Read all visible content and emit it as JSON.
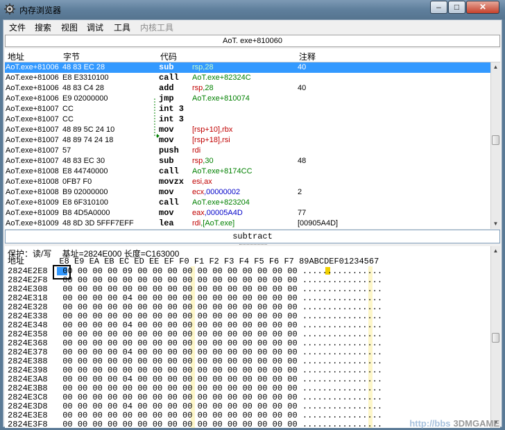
{
  "window": {
    "title": "内存浏览器",
    "minimize": "–",
    "maximize": "□",
    "close": "✕"
  },
  "menu": [
    "文件",
    "搜索",
    "视图",
    "调试",
    "工具",
    "内核工具"
  ],
  "address_bar": "AoT. exe+810060",
  "disasm": {
    "headers": {
      "address": "地址",
      "bytes": "字节",
      "opcode": "代码",
      "comment": "注释"
    },
    "rows": [
      {
        "address": "AoT.exe+81006",
        "bytes": "48 83 EC 28",
        "opcode": "sub",
        "args": [
          [
            "r",
            "rsp"
          ],
          [
            "g",
            ",28"
          ]
        ],
        "comment": "40"
      },
      {
        "address": "AoT.exe+81006",
        "bytes": "E8 E3310100",
        "opcode": "call",
        "args": [
          [
            "g",
            "AoT.exe+82324C"
          ]
        ],
        "comment": ""
      },
      {
        "address": "AoT.exe+81006",
        "bytes": "48 83 C4 28",
        "opcode": "add",
        "args": [
          [
            "r",
            "rsp"
          ],
          [
            "g",
            ",28"
          ]
        ],
        "comment": "40"
      },
      {
        "address": "AoT.exe+81006",
        "bytes": "E9 02000000",
        "opcode": "jmp",
        "args": [
          [
            "g",
            "AoT.exe+810074"
          ]
        ],
        "comment": ""
      },
      {
        "address": "AoT.exe+81007",
        "bytes": "CC",
        "opcode": "int 3",
        "args": [],
        "comment": ""
      },
      {
        "address": "AoT.exe+81007",
        "bytes": "CC",
        "opcode": "int 3",
        "args": [],
        "comment": ""
      },
      {
        "address": "AoT.exe+81007",
        "bytes": "48 89 5C 24 10",
        "opcode": "mov",
        "args": [
          [
            "r",
            "[rsp+10]"
          ],
          [
            "r",
            ",rbx"
          ]
        ],
        "comment": ""
      },
      {
        "address": "AoT.exe+81007",
        "bytes": "48 89 74 24 18",
        "opcode": "mov",
        "args": [
          [
            "r",
            "[rsp+18]"
          ],
          [
            "r",
            ",rsi"
          ]
        ],
        "comment": ""
      },
      {
        "address": "AoT.exe+81007",
        "bytes": "57",
        "opcode": "push",
        "args": [
          [
            "r",
            "rdi"
          ]
        ],
        "comment": ""
      },
      {
        "address": "AoT.exe+81007",
        "bytes": "48 83 EC 30",
        "opcode": "sub",
        "args": [
          [
            "r",
            "rsp"
          ],
          [
            "g",
            ",30"
          ]
        ],
        "comment": "48"
      },
      {
        "address": "AoT.exe+81008",
        "bytes": "E8 44740000",
        "opcode": "call",
        "args": [
          [
            "g",
            "AoT.exe+8174CC"
          ]
        ],
        "comment": ""
      },
      {
        "address": "AoT.exe+81008",
        "bytes": "0FB7 F0",
        "opcode": "movzx",
        "args": [
          [
            "r",
            "esi"
          ],
          [
            "r",
            ",ax"
          ]
        ],
        "comment": ""
      },
      {
        "address": "AoT.exe+81008",
        "bytes": "B9 02000000",
        "opcode": "mov",
        "args": [
          [
            "r",
            "ecx"
          ],
          [
            "b",
            ",00000002"
          ]
        ],
        "comment": "2"
      },
      {
        "address": "AoT.exe+81009",
        "bytes": "E8 6F310100",
        "opcode": "call",
        "args": [
          [
            "g",
            "AoT.exe+823204"
          ]
        ],
        "comment": ""
      },
      {
        "address": "AoT.exe+81009",
        "bytes": "B8 4D5A0000",
        "opcode": "mov",
        "args": [
          [
            "r",
            "eax"
          ],
          [
            "b",
            ",00005A4D"
          ]
        ],
        "comment": "77"
      },
      {
        "address": "AoT.exe+81009",
        "bytes": "48 8D 3D 5FFF7EFF",
        "opcode": "lea",
        "args": [
          [
            "r",
            "rdi"
          ],
          [
            "g",
            ",[AoT.exe]"
          ]
        ],
        "comment": "[00905A4D]"
      }
    ]
  },
  "command_box": "subtract",
  "hex": {
    "protection": "保护：读/写　 基址=2824E000 长度=C163000",
    "header": "地址       E8 E9 EA EB EC ED EE EF F0 F1 F2 F3 F4 F5 F6 F7 89ABCDEF01234567",
    "rows": [
      "2824E2E8   00 00 00 00 09 00 00 00 00 00 00 00 00 00 00 00 ................",
      "2824E2F8   00 00 00 00 00 00 00 00 00 00 00 00 00 00 00 00 ................",
      "2824E308   00 00 00 00 00 00 00 00 00 00 00 00 00 00 00 00 ................",
      "2824E318   00 00 00 00 04 00 00 00 00 00 00 00 00 00 00 00 ................",
      "2824E328   00 00 00 00 00 00 00 00 00 00 00 00 00 00 00 00 ................",
      "2824E338   00 00 00 00 00 00 00 00 00 00 00 00 00 00 00 00 ................",
      "2824E348   00 00 00 00 04 00 00 00 00 00 00 00 00 00 00 00 ................",
      "2824E358   00 00 00 00 00 00 00 00 00 00 00 00 00 00 00 00 ................",
      "2824E368   00 00 00 00 00 00 00 00 00 00 00 00 00 00 00 00 ................",
      "2824E378   00 00 00 00 04 00 00 00 00 00 00 00 00 00 00 00 ................",
      "2824E388   00 00 00 00 00 00 00 00 00 00 00 00 00 00 00 00 ................",
      "2824E398   00 00 00 00 00 00 00 00 00 00 00 00 00 00 00 00 ................",
      "2824E3A8   00 00 00 00 04 00 00 00 00 00 00 00 00 00 00 00 ................",
      "2824E3B8   00 00 00 00 00 00 00 00 00 00 00 00 00 00 00 00 ................",
      "2824E3C8   00 00 00 00 00 00 00 00 00 00 00 00 00 00 00 00 ................",
      "2824E3D8   00 00 00 00 04 00 00 00 00 00 00 00 00 00 00 00 ................",
      "2824E3E8   00 00 00 00 00 00 00 00 00 00 00 00 00 00 00 00 ................",
      "2824E3F8   00 00 00 00 00 00 00 00 00 00 00 00 00 00 00 00 ................"
    ]
  },
  "watermark": {
    "url": "http://bbs",
    "brand": "3DMGAME"
  },
  "colors": {
    "selection": "#3399ff",
    "register": "#c00000",
    "constant": "#008000",
    "hex_literal": "#0000c8",
    "highlight_column": "#fdf6c8"
  },
  "icons": {
    "app": "gear-icon",
    "scroll_up": "triangle-up",
    "scroll_down": "triangle-down"
  }
}
